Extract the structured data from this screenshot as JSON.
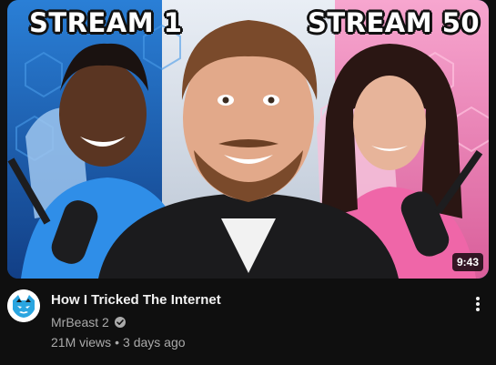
{
  "video": {
    "thumbnail": {
      "text_left": "STREAM 1",
      "text_right": "STREAM 50",
      "duration": "9:43"
    },
    "title": "How I Tricked The Internet",
    "channel": {
      "name": "MrBeast 2",
      "verified": true,
      "avatar_icon": "mrbeast-panther-logo"
    },
    "views": "21M views",
    "separator": "•",
    "age": "3 days ago"
  },
  "icons": {
    "menu": "more-vert-icon",
    "verified": "checkmark-badge-icon"
  },
  "colors": {
    "background": "#0f0f0f",
    "title": "#f1f1f1",
    "secondary_text": "#aaaaaa",
    "thumb_left_bg": "#1a5aa8",
    "thumb_right_bg": "#e07ab0"
  }
}
